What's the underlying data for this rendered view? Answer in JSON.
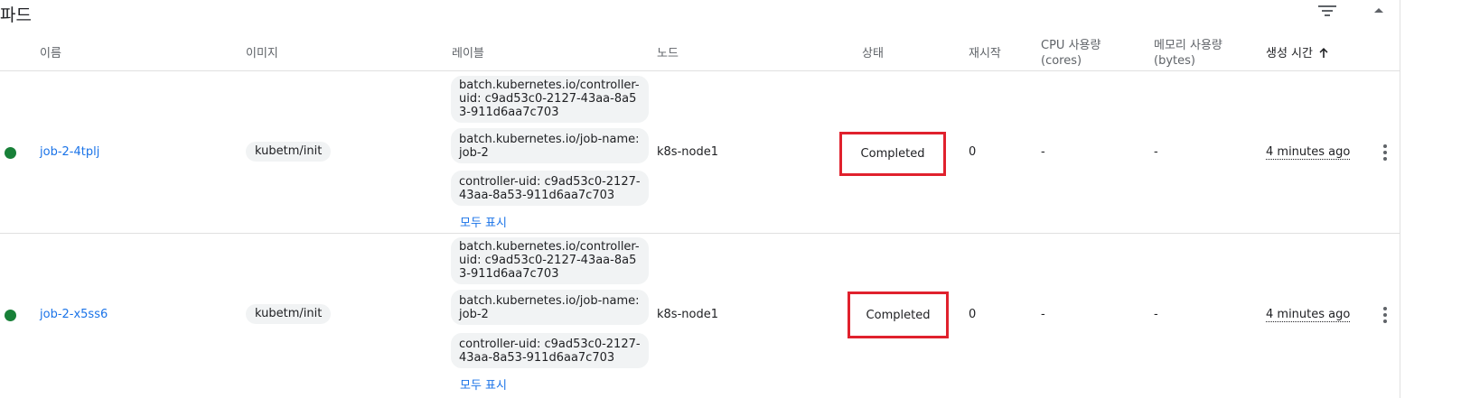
{
  "section": {
    "title": "파드",
    "filter_icon": "filter-list-icon",
    "collapse_icon": "chevron-up-icon"
  },
  "columns": {
    "name": "이름",
    "image": "이미지",
    "labels": "레이블",
    "node": "노드",
    "status": "상태",
    "restarts": "재시작",
    "cpu_line1": "CPU 사용량",
    "cpu_line2": "(cores)",
    "mem_line1": "메모리 사용량",
    "mem_line2": "(bytes)",
    "created": "생성 시간",
    "created_sort_icon": "arrow-upward-icon"
  },
  "colors": {
    "status_ok": "#188038",
    "link": "#1a73e8",
    "highlight_box": "#e0212d"
  },
  "rows": [
    {
      "name": "job-2-4tplj",
      "image": "kubetm/init",
      "labels": [
        "batch.kubernetes.io/controller-uid: c9ad53c0-2127-43aa-8a53-911d6aa7c703",
        "batch.kubernetes.io/job-name: job-2",
        "controller-uid: c9ad53c0-2127-43aa-8a53-911d6aa7c703"
      ],
      "show_all": "모두 표시",
      "node": "k8s-node1",
      "status": "Completed",
      "restarts": "0",
      "cpu": "-",
      "memory": "-",
      "created": "4 minutes ago"
    },
    {
      "name": "job-2-x5ss6",
      "image": "kubetm/init",
      "labels": [
        "batch.kubernetes.io/controller-uid: c9ad53c0-2127-43aa-8a53-911d6aa7c703",
        "batch.kubernetes.io/job-name: job-2",
        "controller-uid: c9ad53c0-2127-43aa-8a53-911d6aa7c703"
      ],
      "show_all": "모두 표시",
      "node": "k8s-node1",
      "status": "Completed",
      "restarts": "0",
      "cpu": "-",
      "memory": "-",
      "created": "4 minutes ago"
    }
  ]
}
